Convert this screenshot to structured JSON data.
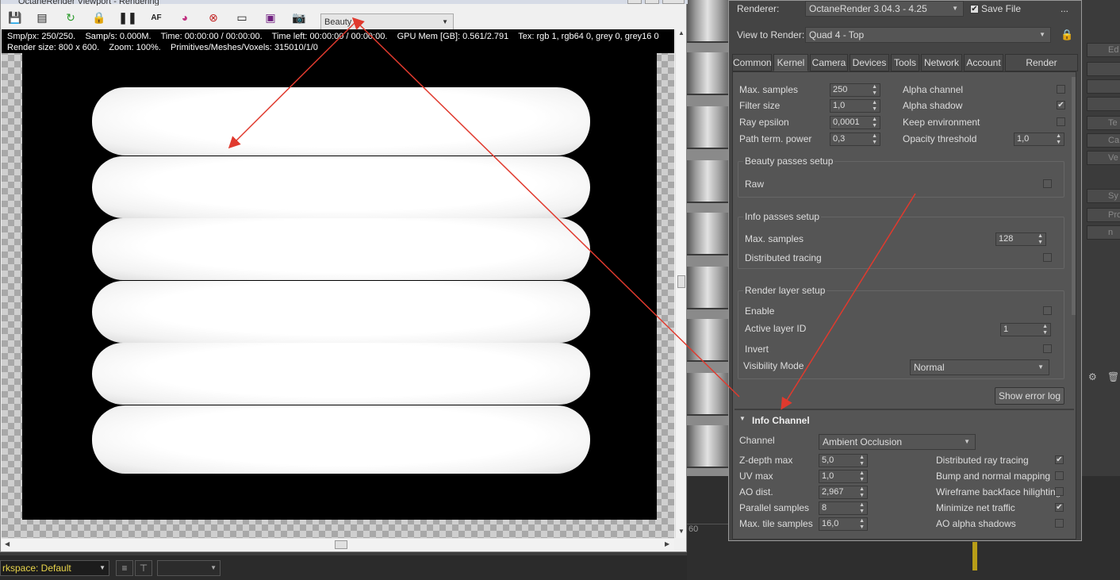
{
  "render_window": {
    "title": "OctaneRender Viewport - Rendering",
    "render_pass": "Beauty",
    "info_line1": "Smp/px: 250/250.    Samp/s: 0.000M.    Time: 00:00:00 / 00:00:00.    Time left: 00:00:00 / 00:00:00.    GPU Mem [GB]: 0.561/2.791    Tex: rgb 1, rgb64 0, grey 0, grey16 0",
    "info_line2": "Render size: 800 x 600.    Zoom: 100%.    Primitives/Meshes/Voxels: 315010/1/0",
    "toolbar_icons": [
      "save-image-icon",
      "copy-image-icon",
      "restart-render-icon",
      "lock-icon",
      "pause-icon",
      "af-focus-icon",
      "color-picker-icon",
      "region-render-icon",
      "viewport-icon",
      "film-region-icon",
      "camera-icon"
    ]
  },
  "timeline": {
    "frame_label": "60"
  },
  "workspace": {
    "label": "rkspace: Default"
  },
  "right_strip": {
    "items": [
      "Ed",
      "",
      "",
      "",
      "Te",
      "Ca",
      "Ve",
      "Sy",
      "Pro",
      "n"
    ]
  },
  "setup": {
    "renderer_label": "Renderer:",
    "renderer_value": "OctaneRender 3.04.3 - 4.25",
    "save_file_label": "Save File",
    "save_file_checked": "✔",
    "more_label": "...",
    "view_label": "View to Render:",
    "view_value": "Quad 4 - Top",
    "tabs": [
      "Common",
      "Kernel",
      "Camera",
      "Devices",
      "Tools",
      "Network",
      "Account",
      "Render Elements"
    ],
    "kernel": {
      "max_samples_label": "Max. samples",
      "max_samples": "250",
      "filter_size_label": "Filter size",
      "filter_size": "1,0",
      "ray_epsilon_label": "Ray epsilon",
      "ray_epsilon": "0,0001",
      "path_term_label": "Path term. power",
      "path_term": "0,3",
      "alpha_channel_label": "Alpha channel",
      "alpha_channel": "",
      "alpha_shadow_label": "Alpha shadow",
      "alpha_shadow": "✔",
      "keep_env_label": "Keep environment",
      "keep_env": "",
      "opacity_label": "Opacity threshold",
      "opacity": "1,0"
    },
    "beauty_passes": {
      "title": "Beauty passes setup",
      "raw_label": "Raw",
      "raw": ""
    },
    "info_passes": {
      "title": "Info passes setup",
      "max_samples_label": "Max. samples",
      "max_samples": "128",
      "dist_tracing_label": "Distributed tracing",
      "dist_tracing": ""
    },
    "render_layer": {
      "title": "Render layer setup",
      "enable_label": "Enable",
      "enable": "",
      "active_layer_label": "Active layer ID",
      "active_layer": "1",
      "invert_label": "Invert",
      "invert": "",
      "visibility_label": "Visibility Mode",
      "visibility": "Normal"
    },
    "show_error_log": "Show error log",
    "info_channel": {
      "title": "Info Channel",
      "channel_label": "Channel",
      "channel": "Ambient Occlusion",
      "zdepth_label": "Z-depth max",
      "zdepth": "5,0",
      "uv_label": "UV max",
      "uv": "1,0",
      "ao_label": "AO dist.",
      "ao": "2,967",
      "parallel_label": "Parallel samples",
      "parallel": "8",
      "tile_label": "Max. tile samples",
      "tile": "16,0",
      "dist_ray_label": "Distributed ray tracing",
      "dist_ray": "✔",
      "bump_label": "Bump and normal mapping",
      "bump": "",
      "wireframe_label": "Wireframe backface hilighting",
      "wireframe": "",
      "min_net_label": "Minimize net traffic",
      "min_net": "✔",
      "ao_alpha_label": "AO alpha shadows",
      "ao_alpha": ""
    }
  },
  "colors": {
    "annotation_arrow": "#e03a2e",
    "workspace_text": "#e8d44a",
    "timeline_marker": "#b89e18"
  }
}
